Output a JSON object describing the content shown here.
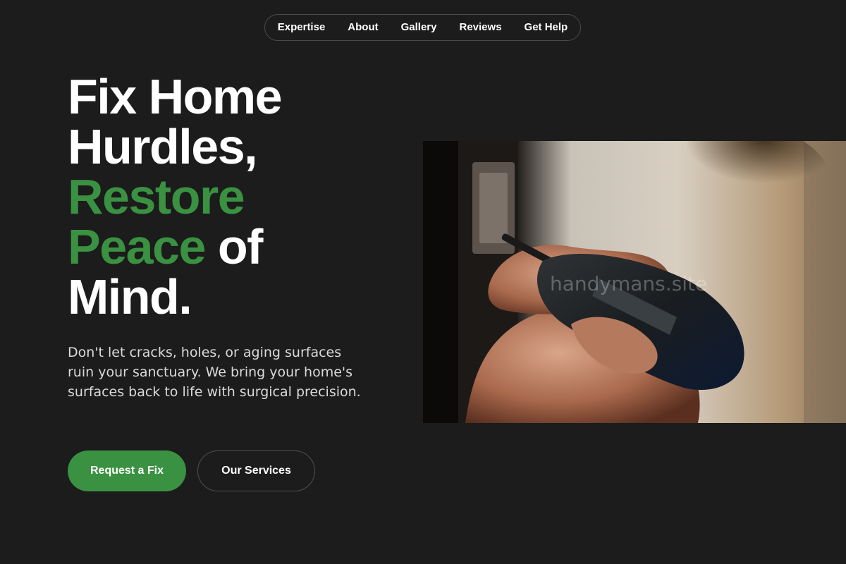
{
  "nav": {
    "items": [
      {
        "label": "Expertise"
      },
      {
        "label": "About"
      },
      {
        "label": "Gallery"
      },
      {
        "label": "Reviews"
      },
      {
        "label": "Get Help"
      }
    ]
  },
  "hero": {
    "headline": {
      "line1": "Fix Home",
      "line2": "Hurdles,",
      "line3_green": "Restore",
      "line4_green": "Peace",
      "line4_white": " of",
      "line5": "Mind."
    },
    "description": "Don't let cracks, holes, or aging surfaces ruin your sanctuary. We bring your home's surfaces back to life with surgical precision.",
    "primary_button": "Request a Fix",
    "secondary_button": "Our Services",
    "image": {
      "subject": "hands operating a cordless drill on a door hinge",
      "watermark": "handymans.site"
    }
  },
  "colors": {
    "background": "#1b1c1b",
    "accent": "#3a9141",
    "text": "#ffffff"
  }
}
